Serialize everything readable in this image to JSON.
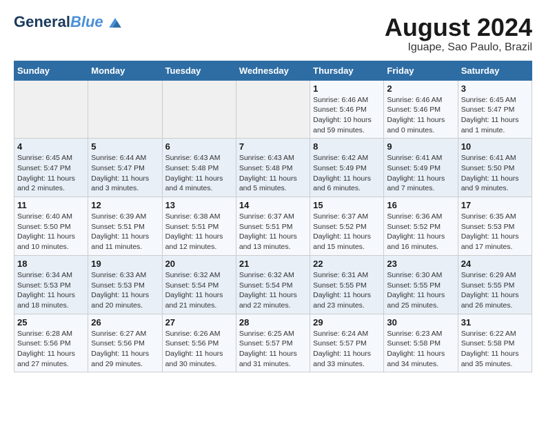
{
  "header": {
    "logo_line1": "General",
    "logo_line2": "Blue",
    "month_title": "August 2024",
    "location": "Iguape, Sao Paulo, Brazil"
  },
  "calendar": {
    "weekdays": [
      "Sunday",
      "Monday",
      "Tuesday",
      "Wednesday",
      "Thursday",
      "Friday",
      "Saturday"
    ],
    "weeks": [
      [
        {
          "day": "",
          "info": ""
        },
        {
          "day": "",
          "info": ""
        },
        {
          "day": "",
          "info": ""
        },
        {
          "day": "",
          "info": ""
        },
        {
          "day": "1",
          "info": "Sunrise: 6:46 AM\nSunset: 5:46 PM\nDaylight: 10 hours\nand 59 minutes."
        },
        {
          "day": "2",
          "info": "Sunrise: 6:46 AM\nSunset: 5:46 PM\nDaylight: 11 hours\nand 0 minutes."
        },
        {
          "day": "3",
          "info": "Sunrise: 6:45 AM\nSunset: 5:47 PM\nDaylight: 11 hours\nand 1 minute."
        }
      ],
      [
        {
          "day": "4",
          "info": "Sunrise: 6:45 AM\nSunset: 5:47 PM\nDaylight: 11 hours\nand 2 minutes."
        },
        {
          "day": "5",
          "info": "Sunrise: 6:44 AM\nSunset: 5:47 PM\nDaylight: 11 hours\nand 3 minutes."
        },
        {
          "day": "6",
          "info": "Sunrise: 6:43 AM\nSunset: 5:48 PM\nDaylight: 11 hours\nand 4 minutes."
        },
        {
          "day": "7",
          "info": "Sunrise: 6:43 AM\nSunset: 5:48 PM\nDaylight: 11 hours\nand 5 minutes."
        },
        {
          "day": "8",
          "info": "Sunrise: 6:42 AM\nSunset: 5:49 PM\nDaylight: 11 hours\nand 6 minutes."
        },
        {
          "day": "9",
          "info": "Sunrise: 6:41 AM\nSunset: 5:49 PM\nDaylight: 11 hours\nand 7 minutes."
        },
        {
          "day": "10",
          "info": "Sunrise: 6:41 AM\nSunset: 5:50 PM\nDaylight: 11 hours\nand 9 minutes."
        }
      ],
      [
        {
          "day": "11",
          "info": "Sunrise: 6:40 AM\nSunset: 5:50 PM\nDaylight: 11 hours\nand 10 minutes."
        },
        {
          "day": "12",
          "info": "Sunrise: 6:39 AM\nSunset: 5:51 PM\nDaylight: 11 hours\nand 11 minutes."
        },
        {
          "day": "13",
          "info": "Sunrise: 6:38 AM\nSunset: 5:51 PM\nDaylight: 11 hours\nand 12 minutes."
        },
        {
          "day": "14",
          "info": "Sunrise: 6:37 AM\nSunset: 5:51 PM\nDaylight: 11 hours\nand 13 minutes."
        },
        {
          "day": "15",
          "info": "Sunrise: 6:37 AM\nSunset: 5:52 PM\nDaylight: 11 hours\nand 15 minutes."
        },
        {
          "day": "16",
          "info": "Sunrise: 6:36 AM\nSunset: 5:52 PM\nDaylight: 11 hours\nand 16 minutes."
        },
        {
          "day": "17",
          "info": "Sunrise: 6:35 AM\nSunset: 5:53 PM\nDaylight: 11 hours\nand 17 minutes."
        }
      ],
      [
        {
          "day": "18",
          "info": "Sunrise: 6:34 AM\nSunset: 5:53 PM\nDaylight: 11 hours\nand 18 minutes."
        },
        {
          "day": "19",
          "info": "Sunrise: 6:33 AM\nSunset: 5:53 PM\nDaylight: 11 hours\nand 20 minutes."
        },
        {
          "day": "20",
          "info": "Sunrise: 6:32 AM\nSunset: 5:54 PM\nDaylight: 11 hours\nand 21 minutes."
        },
        {
          "day": "21",
          "info": "Sunrise: 6:32 AM\nSunset: 5:54 PM\nDaylight: 11 hours\nand 22 minutes."
        },
        {
          "day": "22",
          "info": "Sunrise: 6:31 AM\nSunset: 5:55 PM\nDaylight: 11 hours\nand 23 minutes."
        },
        {
          "day": "23",
          "info": "Sunrise: 6:30 AM\nSunset: 5:55 PM\nDaylight: 11 hours\nand 25 minutes."
        },
        {
          "day": "24",
          "info": "Sunrise: 6:29 AM\nSunset: 5:55 PM\nDaylight: 11 hours\nand 26 minutes."
        }
      ],
      [
        {
          "day": "25",
          "info": "Sunrise: 6:28 AM\nSunset: 5:56 PM\nDaylight: 11 hours\nand 27 minutes."
        },
        {
          "day": "26",
          "info": "Sunrise: 6:27 AM\nSunset: 5:56 PM\nDaylight: 11 hours\nand 29 minutes."
        },
        {
          "day": "27",
          "info": "Sunrise: 6:26 AM\nSunset: 5:56 PM\nDaylight: 11 hours\nand 30 minutes."
        },
        {
          "day": "28",
          "info": "Sunrise: 6:25 AM\nSunset: 5:57 PM\nDaylight: 11 hours\nand 31 minutes."
        },
        {
          "day": "29",
          "info": "Sunrise: 6:24 AM\nSunset: 5:57 PM\nDaylight: 11 hours\nand 33 minutes."
        },
        {
          "day": "30",
          "info": "Sunrise: 6:23 AM\nSunset: 5:58 PM\nDaylight: 11 hours\nand 34 minutes."
        },
        {
          "day": "31",
          "info": "Sunrise: 6:22 AM\nSunset: 5:58 PM\nDaylight: 11 hours\nand 35 minutes."
        }
      ]
    ]
  }
}
